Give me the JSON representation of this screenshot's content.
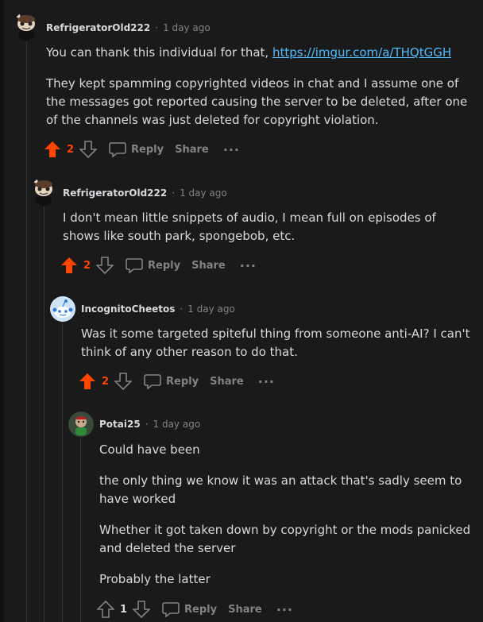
{
  "comments": [
    {
      "author": "RefrigeratorOld222",
      "sep": "·",
      "time": "1 day ago",
      "paragraphs": [
        "They kept spamming copyrighted videos in chat and I assume one of the messages got reported causing the server to be deleted, after one of the channels was just deleted for copyright violation."
      ],
      "intro": "You can thank this individual for that, ",
      "link": "https://imgur.com/a/THQtGGH",
      "score": "2",
      "reply_label": "Reply",
      "share_label": "Share",
      "more_label": "···",
      "upvoted": true
    },
    {
      "author": "RefrigeratorOld222",
      "sep": "·",
      "time": "1 day ago",
      "paragraphs": [
        "I don't mean little snippets of audio, I mean full on episodes of shows like south park, spongebob, etc."
      ],
      "score": "2",
      "reply_label": "Reply",
      "share_label": "Share",
      "more_label": "···",
      "upvoted": true
    },
    {
      "author": "IncognitoCheetos",
      "sep": "·",
      "time": "1 day ago",
      "paragraphs": [
        "Was it some targeted spiteful thing from someone anti-AI? I can't think of any other reason to do that."
      ],
      "score": "2",
      "reply_label": "Reply",
      "share_label": "Share",
      "more_label": "···",
      "upvoted": true
    },
    {
      "author": "Potai25",
      "sep": "·",
      "time": "1 day ago",
      "paragraphs": [
        "Could have been",
        "the only thing we know it was an attack that's sadly seem to have worked",
        "Whether it got taken down by copyright or the mods panicked and deleted the server",
        "Probably the latter"
      ],
      "score": "1",
      "reply_label": "Reply",
      "share_label": "Share",
      "more_label": "···",
      "upvoted": false
    }
  ],
  "colors": {
    "background": "#1a1a1b",
    "upvote": "#ff4500",
    "link": "#4fbcff",
    "muted": "#818384",
    "thread_line": "#343536"
  }
}
